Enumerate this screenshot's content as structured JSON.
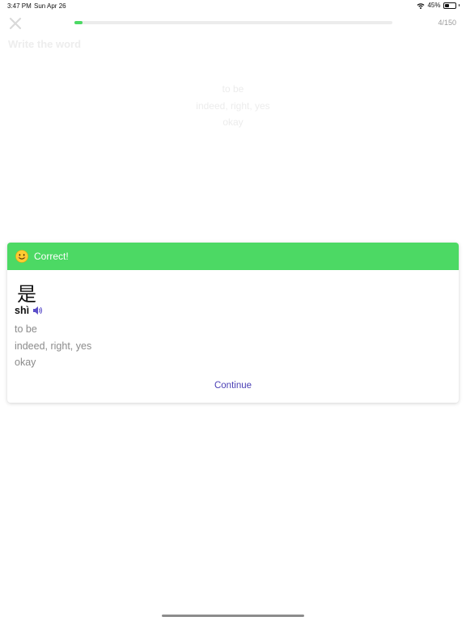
{
  "status_bar": {
    "time": "3:47 PM",
    "date": "Sun Apr 26",
    "battery_text": "45%",
    "battery_level": 0.45
  },
  "lesson": {
    "close_icon": "close-x-icon",
    "progress_fraction": 0.0267,
    "progress_count": "4/150",
    "title": "Write the word",
    "meanings": [
      "to be",
      "indeed, right, yes",
      "okay"
    ]
  },
  "result": {
    "header_text": "Correct!",
    "header_icon": "smiling-face-icon",
    "header_color": "#4cd964",
    "character": "是",
    "pinyin": "shì",
    "speaker_icon": "speaker-icon",
    "meanings": [
      "to be",
      "indeed, right, yes",
      "okay"
    ],
    "continue_label": "Continue",
    "continue_color": "#4a3fb5"
  }
}
